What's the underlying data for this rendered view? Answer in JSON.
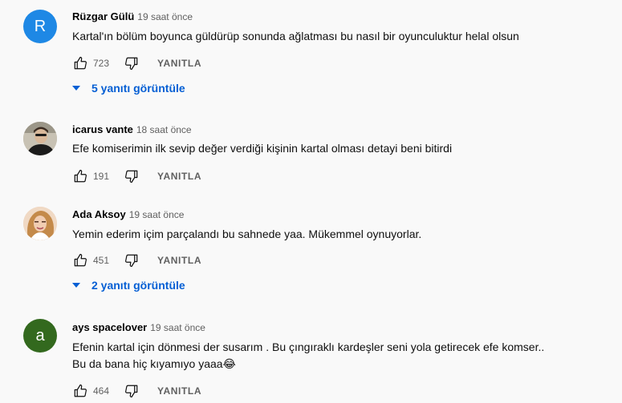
{
  "comments": [
    {
      "author": "Rüzgar Gülü",
      "time": "19 saat önce",
      "avatar_letter": "R",
      "avatar_color": "#1e88e5",
      "text": [
        "Kartal'ın bölüm boyunca güldürüp sonunda ağlatması bu nasıl bir oyunculuktur helal olsun"
      ],
      "likes": "723",
      "reply_label": "YANITLA",
      "replies_label": "5 yanıtı görüntüle"
    },
    {
      "author": "icarus vante",
      "time": "18 saat önce",
      "avatar_letter": "",
      "text": [
        "Efe komiserimin ilk sevip değer verdiği kişinin kartal olması detayi beni bitirdi"
      ],
      "likes": "191",
      "reply_label": "YANITLA"
    },
    {
      "author": "Ada Aksoy",
      "time": "19 saat önce",
      "avatar_letter": "",
      "text": [
        "Yemin ederim içim parçalandı bu sahnede yaa. Mükemmel oynuyorlar."
      ],
      "likes": "451",
      "reply_label": "YANITLA",
      "replies_label": "2 yanıtı görüntüle"
    },
    {
      "author": "ays spacelover",
      "time": "19 saat önce",
      "avatar_letter": "a",
      "avatar_color": "#33691e",
      "text": [
        "Efenin kartal için dönmesi der susarım . Bu çıngıraklı kardeşler seni yola getirecek efe komser..",
        "Bu da bana hiç kıyamıyo yaaa😂"
      ],
      "likes": "464",
      "reply_label": "YANITLA"
    }
  ],
  "icons": {
    "like": "thumbs-up-icon",
    "dislike": "thumbs-down-icon",
    "expand": "triangle-down-icon"
  }
}
